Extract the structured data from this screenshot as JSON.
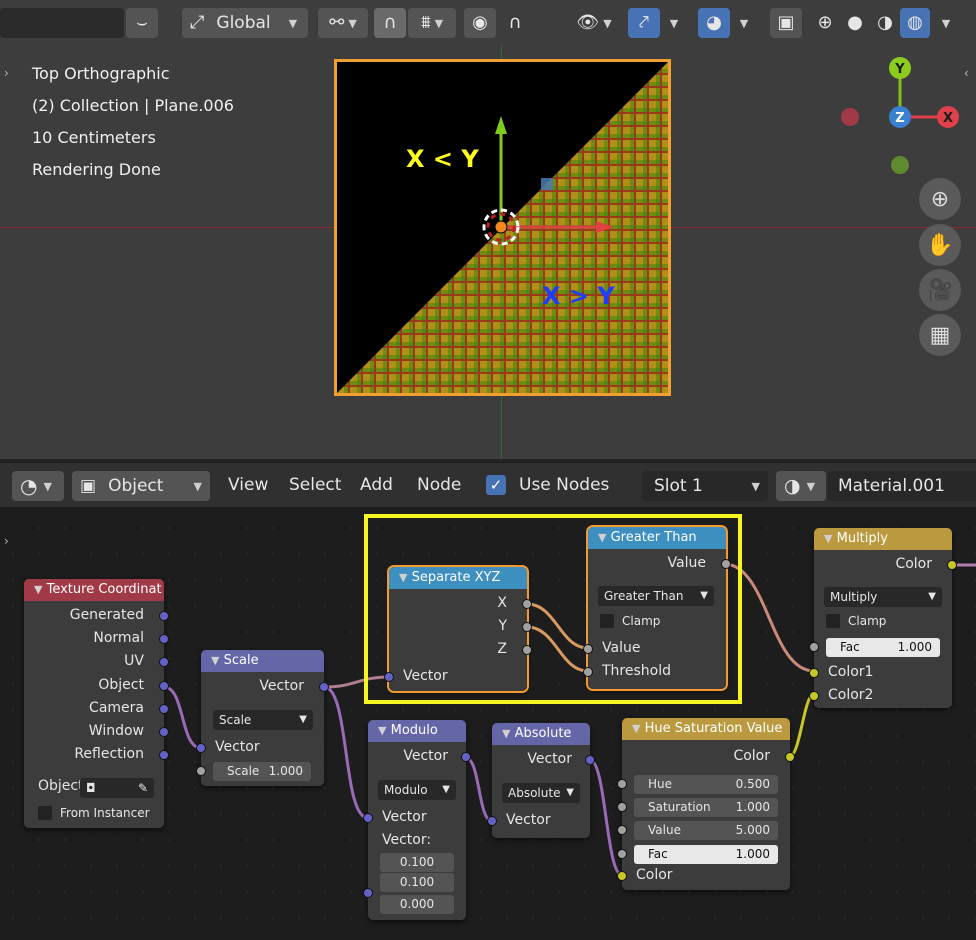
{
  "viewport": {
    "header": {
      "transform_orientation": "Global"
    },
    "info_lines": [
      "Top Orthographic",
      "(2) Collection | Plane.006",
      "10 Centimeters",
      "Rendering Done"
    ],
    "labels": {
      "x_less_y": "X < Y",
      "x_greater_y": "X > Y"
    },
    "gizmo": {
      "y": "Y",
      "z": "Z",
      "x": "X"
    },
    "icons": [
      "orientation-icon",
      "pivot-icon",
      "snap-icon",
      "proportional-icon",
      "visibility-icon",
      "gizmo-icon",
      "overlay-icon",
      "xray-icon",
      "wireframe-icon",
      "solid-icon",
      "material-icon",
      "rendered-icon",
      "zoom-icon",
      "hand-icon",
      "camera-icon",
      "grid-icon"
    ]
  },
  "node_header": {
    "mode": "Object",
    "menus": [
      "View",
      "Select",
      "Add",
      "Node"
    ],
    "use_nodes": "Use Nodes",
    "slot": "Slot 1",
    "material": "Material.001"
  },
  "nodes": {
    "texcoord": {
      "title": "Texture Coordinat",
      "outputs": [
        "Generated",
        "Normal",
        "UV",
        "Object",
        "Camera",
        "Window",
        "Reflection"
      ],
      "object_label": "Object",
      "from_instancer": "From Instancer"
    },
    "scale": {
      "title": "Scale",
      "output": "Vector",
      "op": "Scale",
      "input": "Vector",
      "scale_label": "Scale",
      "scale_value": "1.000"
    },
    "separate": {
      "title": "Separate XYZ",
      "outputs": [
        "X",
        "Y",
        "Z"
      ],
      "input": "Vector"
    },
    "greater": {
      "title": "Greater Than",
      "output": "Value",
      "op": "Greater Than",
      "clamp": "Clamp",
      "inputs": [
        "Value",
        "Threshold"
      ]
    },
    "multiply": {
      "title": "Multiply",
      "output": "Color",
      "op": "Multiply",
      "clamp": "Clamp",
      "fac_label": "Fac",
      "fac_value": "1.000",
      "inputs": [
        "Color1",
        "Color2"
      ]
    },
    "modulo": {
      "title": "Modulo",
      "output": "Vector",
      "op": "Modulo",
      "input": "Vector",
      "vector_label": "Vector:",
      "values": [
        "0.100",
        "0.100",
        "0.000"
      ]
    },
    "absolute": {
      "title": "Absolute",
      "output": "Vector",
      "op": "Absolute",
      "input": "Vector"
    },
    "hsv": {
      "title": "Hue Saturation Value",
      "output": "Color",
      "fields": [
        {
          "label": "Hue",
          "value": "0.500"
        },
        {
          "label": "Saturation",
          "value": "1.000"
        },
        {
          "label": "Value",
          "value": "5.000"
        },
        {
          "label": "Fac",
          "value": "1.000"
        }
      ],
      "input": "Color"
    }
  },
  "colors": {
    "accent": "#4772b3",
    "selection": "#f0a030",
    "highlight_box": "#f5f520"
  }
}
